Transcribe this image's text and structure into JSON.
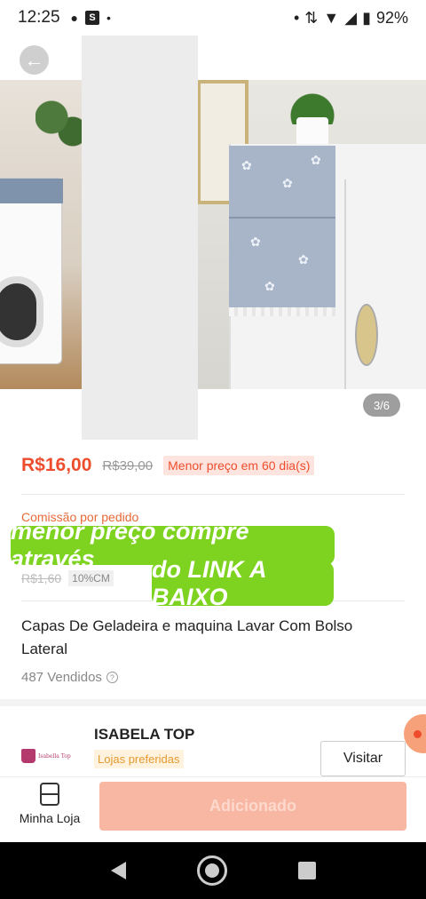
{
  "status_bar": {
    "time": "12:25",
    "battery": "92%"
  },
  "gallery": {
    "page_indicator": "3/6"
  },
  "price": {
    "current": "R$16,00",
    "original": "R$39,00",
    "badge": "Menor preço em 60 dia(s)"
  },
  "commission": {
    "label": "Comissão por pedido",
    "value": "R$1,60",
    "rate": "10%CM"
  },
  "overlay": {
    "line1": "menor preço compre através",
    "line2": "do LINK A BAIXO"
  },
  "product": {
    "title": "Capas De Geladeira e maquina Lavar Com Bolso Lateral",
    "sold": "487 Vendidos"
  },
  "shop": {
    "logo_text": "Isabella Top",
    "name": "ISABELA TOP",
    "badge": "Lojas preferidas",
    "visit_label": "Visitar"
  },
  "action_bar": {
    "store_label": "Minha Loja",
    "add_label": "Adicionado"
  },
  "colors": {
    "accent": "#ee4d2d",
    "overlay_green": "#7ed321"
  }
}
